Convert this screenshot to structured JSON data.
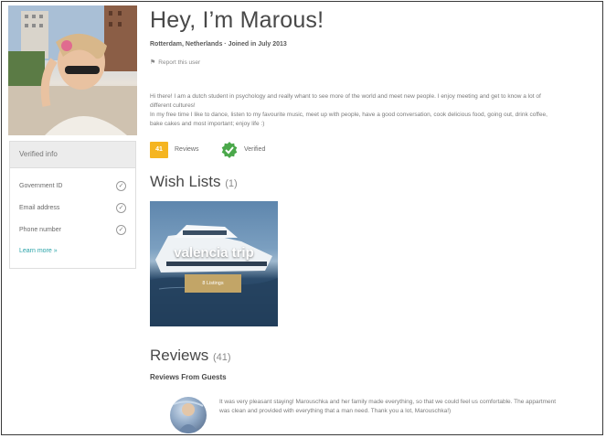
{
  "profile": {
    "title": "Hey, I’m Marous!",
    "location_joined": "Rotterdam, Netherlands · Joined in July 2013",
    "report_label": "Report this user",
    "bio_lines": [
      "Hi there! I am a dutch student in psychology and really whant to see more of the world and meet new people. I enjoy meeting and get to know a lot of different cultures!",
      "In my free time I like to dance, listen to my favourite music, meet up with people, have a good conversation, cook delicious food, going out, drink coffee, bake cakes and most important; enjoy life :)"
    ]
  },
  "verified_info": {
    "heading": "Verified info",
    "items": [
      {
        "label": "Government ID",
        "icon": "check-circle-icon"
      },
      {
        "label": "Email address",
        "icon": "check-circle-icon"
      },
      {
        "label": "Phone number",
        "icon": "check-circle-icon"
      }
    ],
    "learn_more": "Learn more »"
  },
  "badges": {
    "reviews_count": "41",
    "reviews_label": "Reviews",
    "verified_label": "Verified",
    "reviews_color": "#f5b521",
    "verified_color": "#4aa84a"
  },
  "wish_lists": {
    "title": "Wish Lists",
    "count": "(1)",
    "items": [
      {
        "name": "valencia trip",
        "button": "8 Listings"
      }
    ]
  },
  "reviews": {
    "title": "Reviews",
    "count": "(41)",
    "subheading": "Reviews From Guests",
    "items": [
      {
        "text": "It was very pleasant staying! Marouschka and her family made everything, so that we could feel us comfortable. The appartment was clean and provided with everything that a man need. Thank you a lot, Marouschka!)"
      }
    ]
  },
  "colors": {
    "link": "#2aa3a8",
    "wish_button": "#c2a567"
  }
}
